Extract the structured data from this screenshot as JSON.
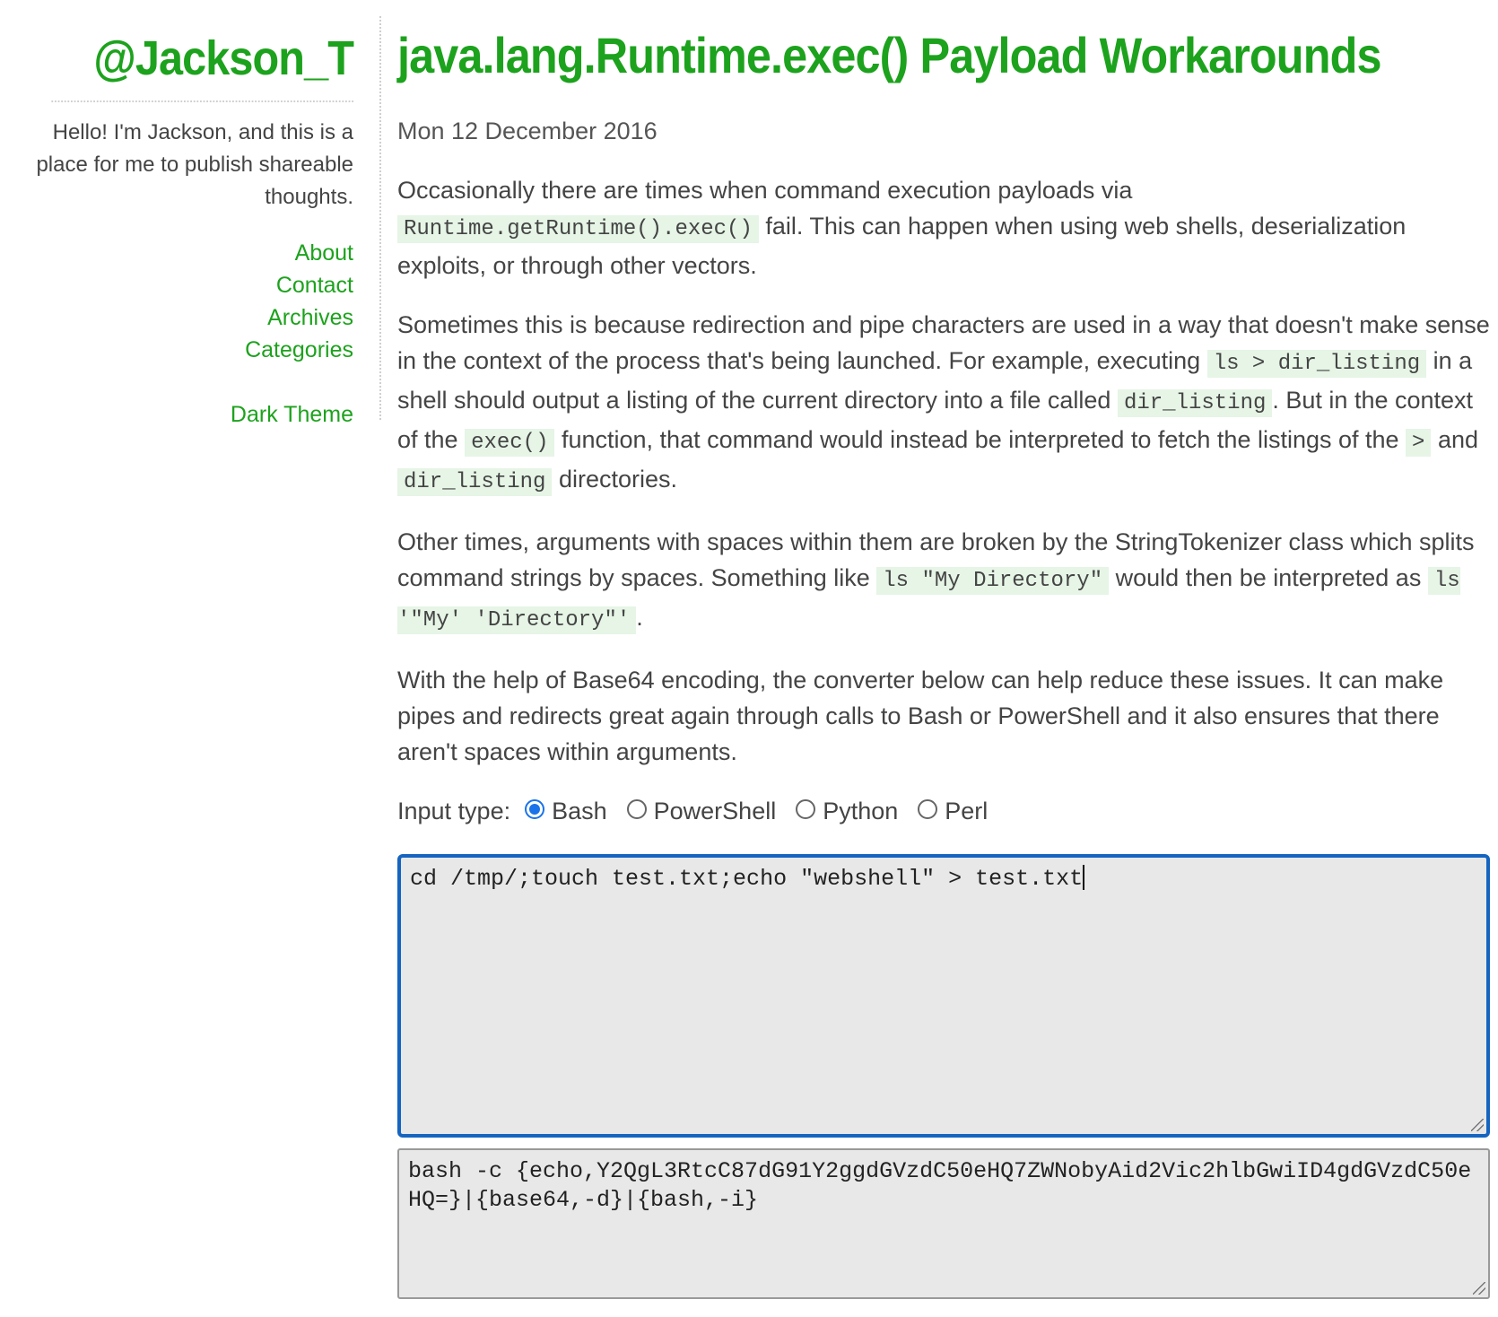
{
  "sidebar": {
    "site_title": "@Jackson_T",
    "description": "Hello! I'm Jackson, and this is a place for me to publish shareable thoughts.",
    "nav": [
      "About",
      "Contact",
      "Archives",
      "Categories"
    ],
    "theme_toggle": "Dark Theme"
  },
  "post": {
    "title": "java.lang.Runtime.exec() Payload Workarounds",
    "date": "Mon 12 December 2016",
    "p1": {
      "t1": "Occasionally there are times when command execution payloads via ",
      "c1": "Runtime.getRuntime().exec()",
      "t2": " fail. This can happen when using web shells, deserialization exploits, or through other vectors."
    },
    "p2": {
      "t1": "Sometimes this is because redirection and pipe characters are used in a way that doesn't make sense in the context of the process that's being launched. For example, executing ",
      "c1": "ls > dir_listing",
      "t2": " in a shell should output a listing of the current directory into a file called ",
      "c2": "dir_listing",
      "t3": ". But in the context of the ",
      "c3": "exec()",
      "t4": " function, that command would instead be interpreted to fetch the listings of the ",
      "c4": ">",
      "t5": " and ",
      "c5": "dir_listing",
      "t6": " directories."
    },
    "p3": {
      "t1": "Other times, arguments with spaces within them are broken by the StringTokenizer class which splits command strings by spaces. Something like ",
      "c1": "ls \"My Directory\"",
      "t2": " would then be interpreted as ",
      "c2": "ls '\"My' 'Directory\"'",
      "t3": "."
    },
    "p4": "With the help of Base64 encoding, the converter below can help reduce these issues. It can make pipes and redirects great again through calls to Bash or PowerShell and it also ensures that there aren't spaces within arguments."
  },
  "converter": {
    "label": "Input type:",
    "options": [
      "Bash",
      "PowerShell",
      "Python",
      "Perl"
    ],
    "selected": "Bash",
    "input_value": "cd /tmp/;touch test.txt;echo \"webshell\" > test.txt",
    "output_value": "bash -c {echo,Y2QgL3RtcC87dG91Y2ggdGVzdC50eHQ7ZWNobyAid2Vic2hlbGwiID4gdGVzdC50eHQ=}|{base64,-d}|{bash,-i}"
  },
  "colors": {
    "accent": "#1da21d",
    "focus": "#1565c0",
    "code_bg": "#e6f5e6"
  }
}
